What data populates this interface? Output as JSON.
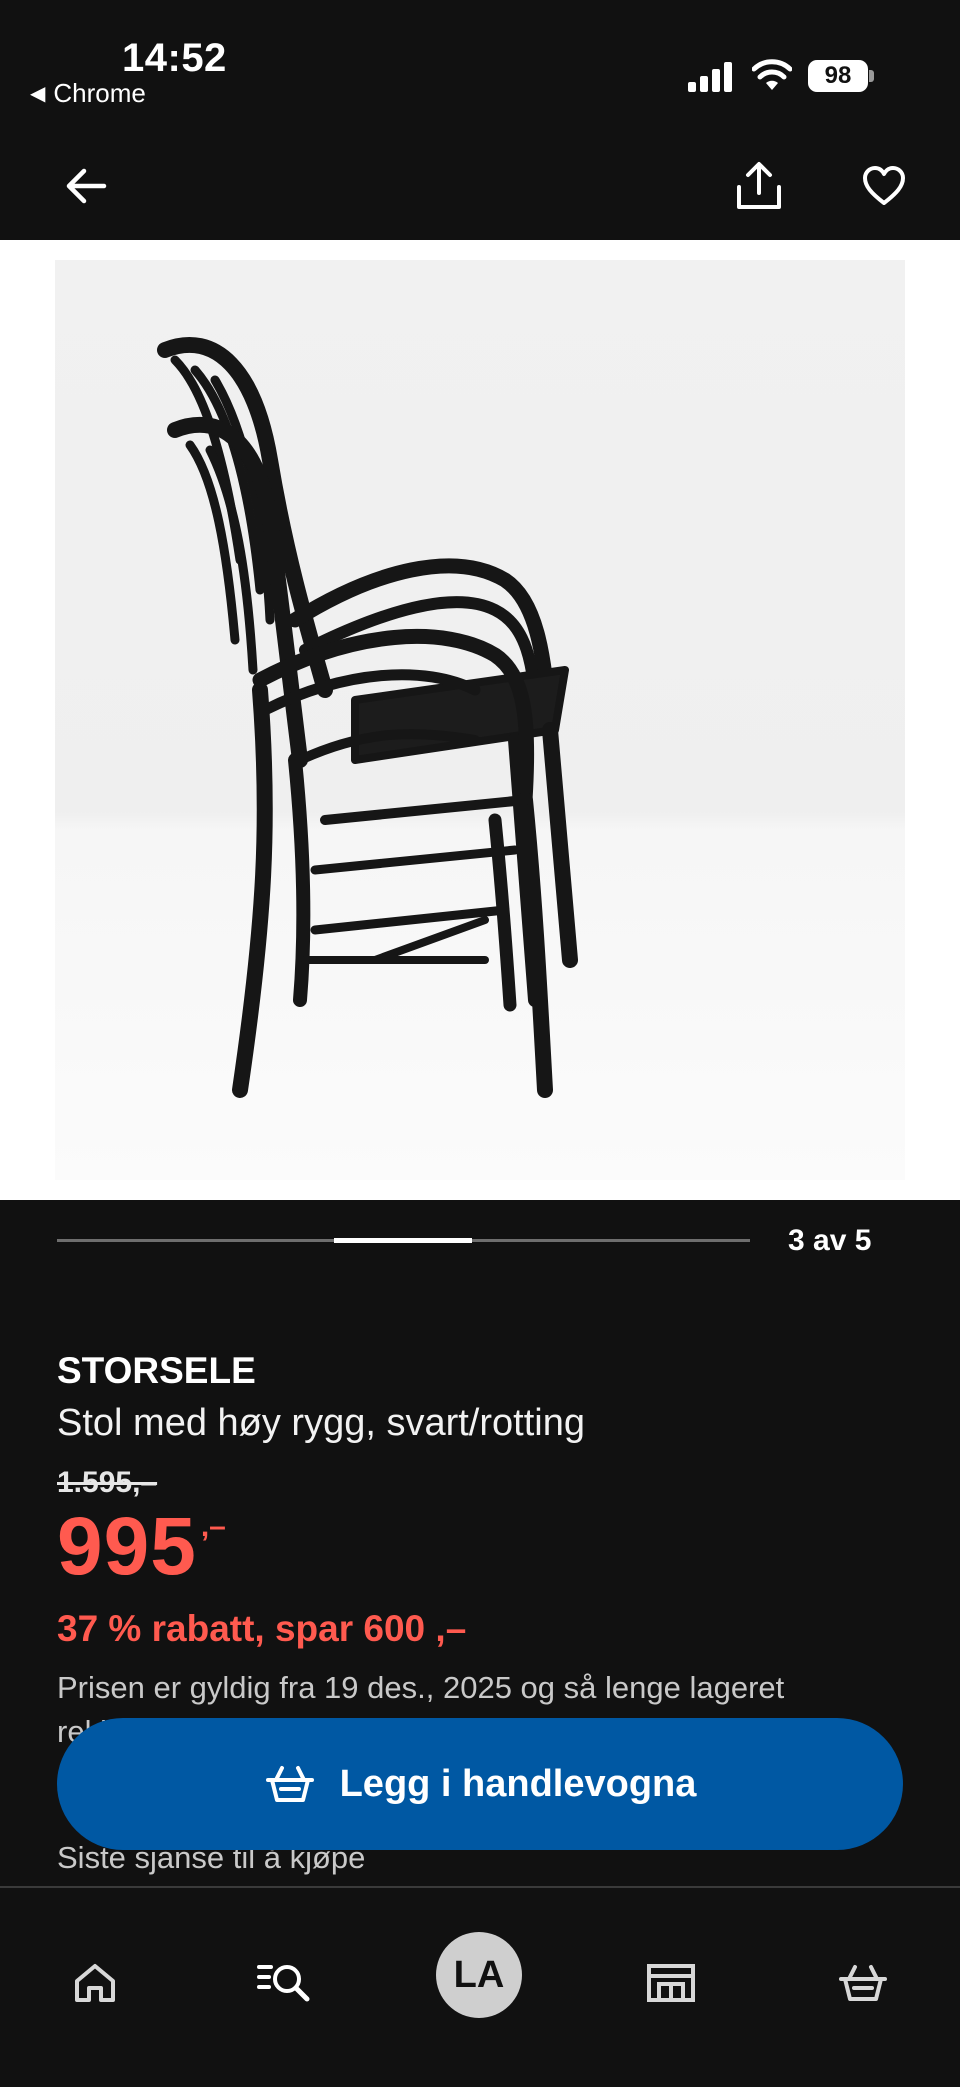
{
  "status_bar": {
    "time": "14:52",
    "back_app": "Chrome",
    "back_arrow": "◀",
    "battery": "98",
    "icons": [
      "signal-icon",
      "wifi-icon",
      "battery-icon"
    ]
  },
  "top_nav": {
    "icons": [
      "back-arrow-icon",
      "share-icon",
      "heart-icon"
    ]
  },
  "image_carousel": {
    "counter": "3 av 5",
    "position": 3,
    "total": 5
  },
  "product": {
    "name": "STORSELE",
    "description": "Stol med høy rygg, svart/rotting",
    "old_price": "1.595,–",
    "price": "995",
    "price_suffix": ",–",
    "discount": "37 % rabatt, spar 600 ,–",
    "validity": "Prisen er gyldig fra 19 des., 2025 og så lenge lageret rekker",
    "last_chance": "Siste sjanse til å kjøpe"
  },
  "cta": {
    "label": "Legg i handlevogna",
    "icon": "basket-icon"
  },
  "bottom_nav": {
    "avatar_initials": "LA",
    "icons": [
      "home-icon",
      "search-icon",
      "avatar",
      "store-icon",
      "basket-icon"
    ]
  },
  "colors": {
    "background": "#111111",
    "price_red": "#ff5a4f",
    "brand_blue": "#0058a3"
  }
}
